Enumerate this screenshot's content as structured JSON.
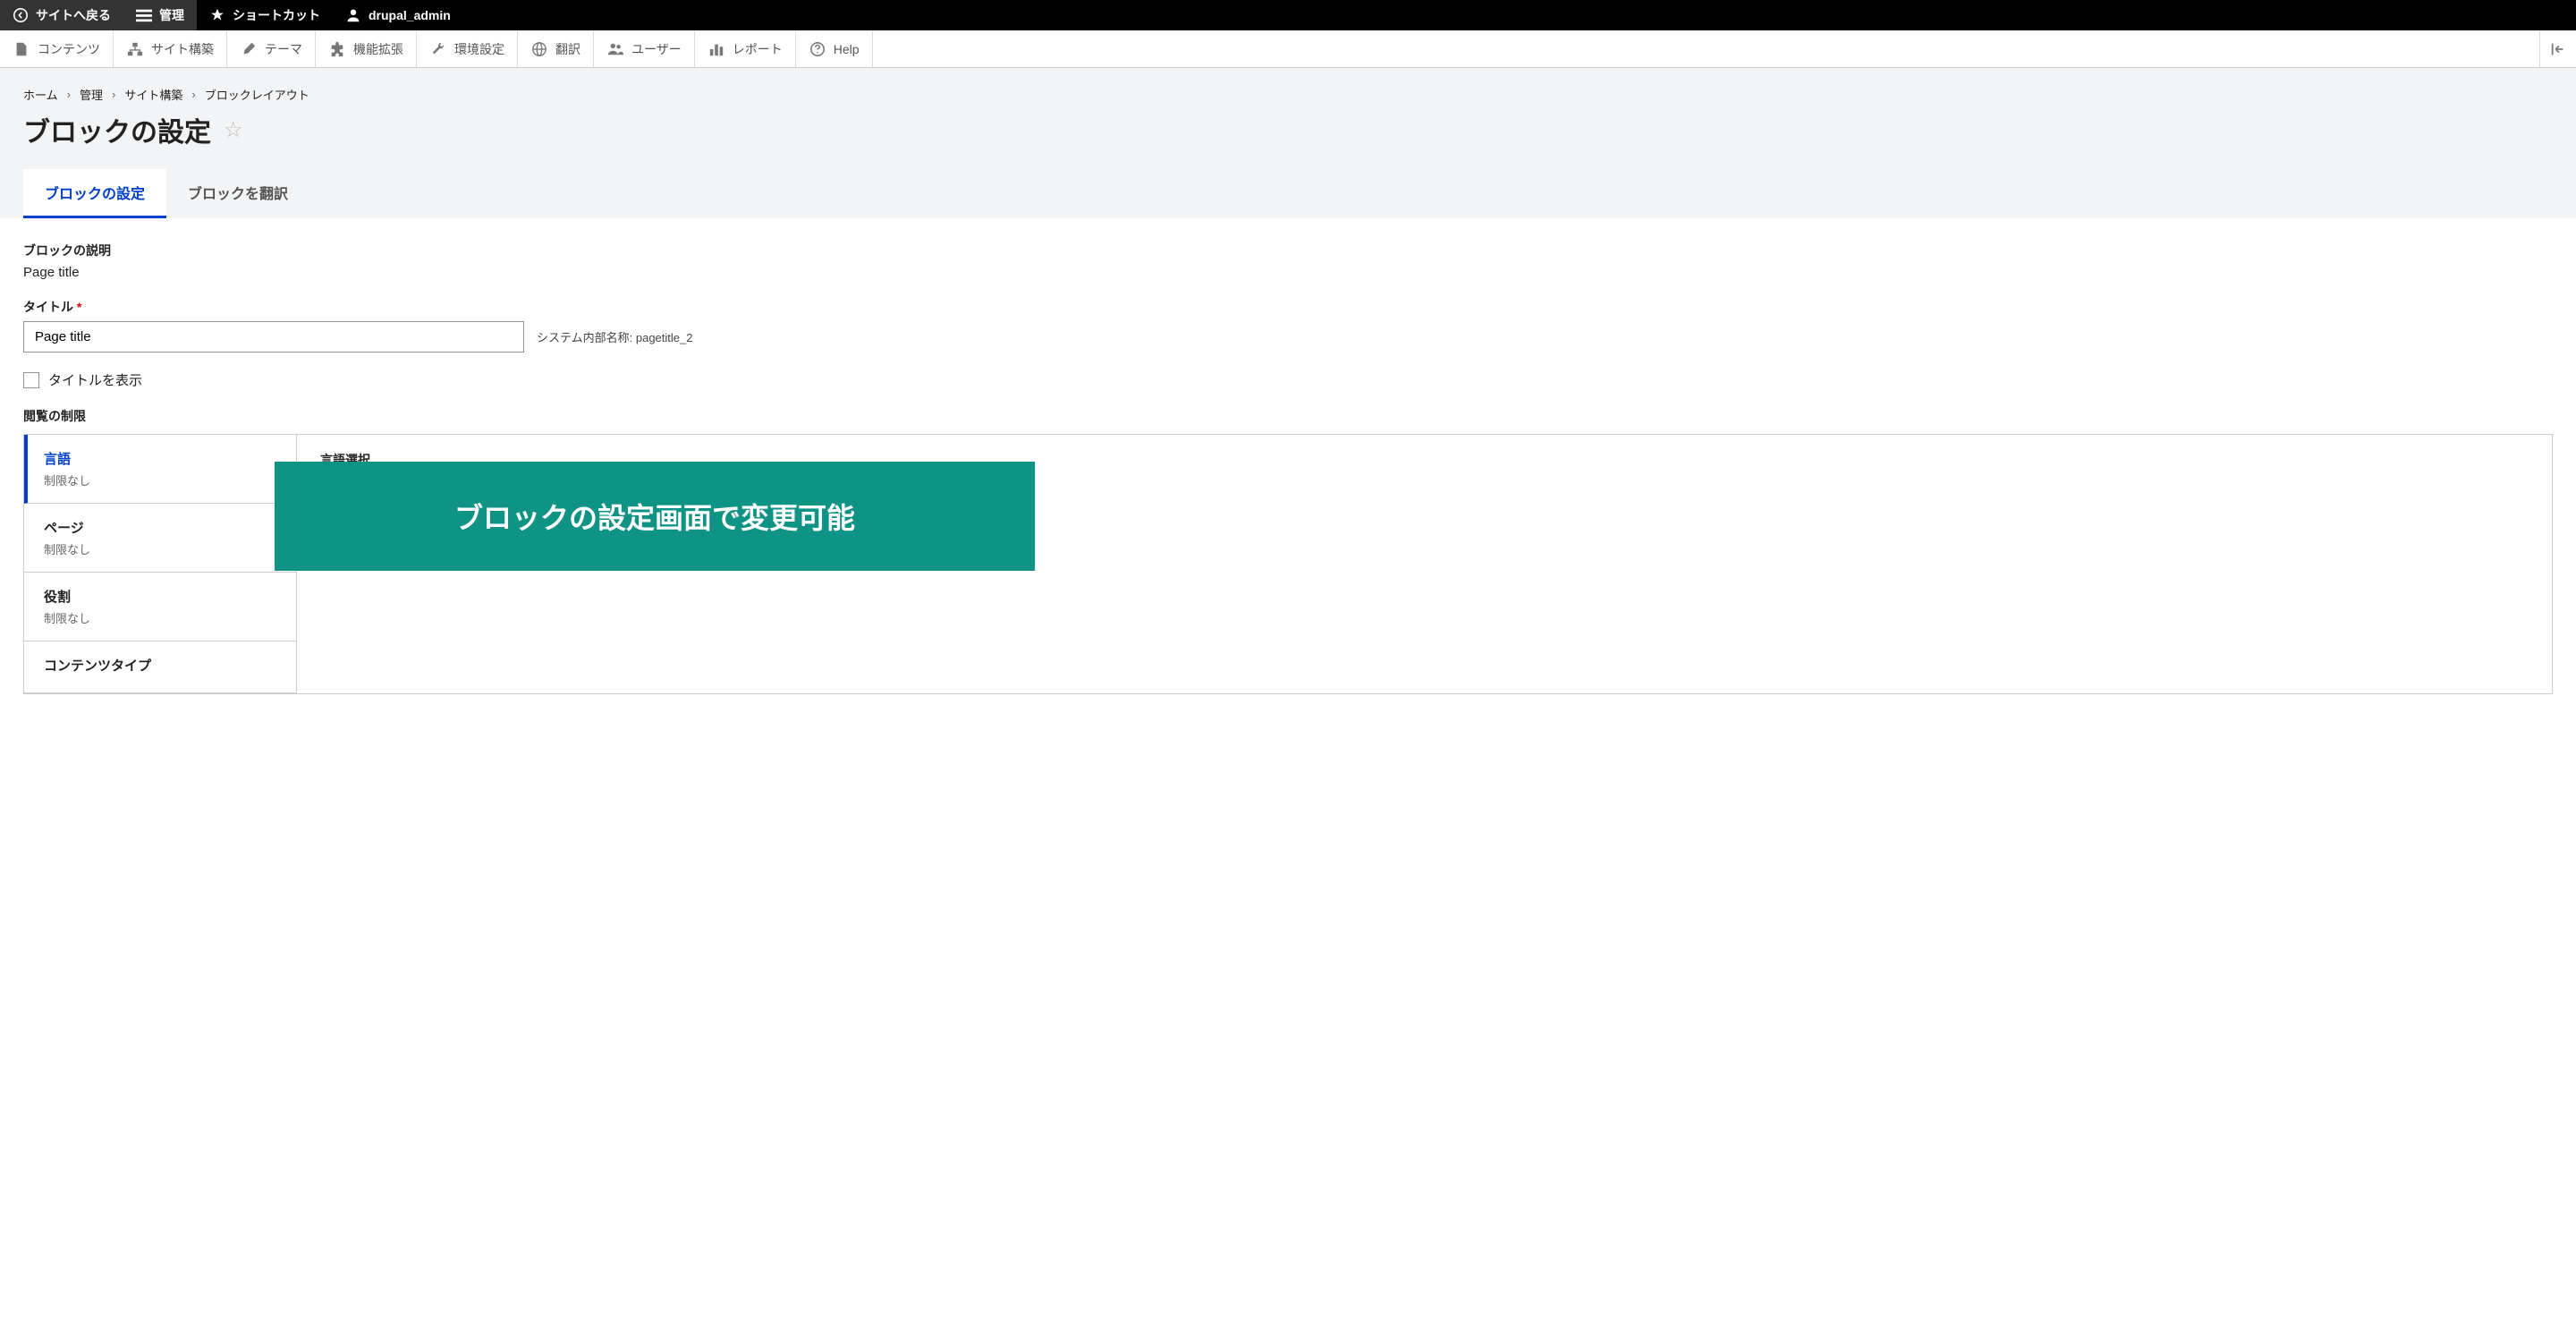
{
  "topbar": {
    "back": "サイトへ戻る",
    "manage": "管理",
    "shortcuts": "ショートカット",
    "user": "drupal_admin"
  },
  "toolbar": {
    "items": [
      {
        "label": "コンテンツ"
      },
      {
        "label": "サイト構築"
      },
      {
        "label": "テーマ"
      },
      {
        "label": "機能拡張"
      },
      {
        "label": "環境設定"
      },
      {
        "label": "翻訳"
      },
      {
        "label": "ユーザー"
      },
      {
        "label": "レポート"
      },
      {
        "label": "Help"
      }
    ]
  },
  "breadcrumb": {
    "items": [
      "ホーム",
      "管理",
      "サイト構築",
      "ブロックレイアウト"
    ],
    "sep": "›"
  },
  "page_title": "ブロックの設定",
  "tabs": [
    {
      "label": "ブロックの設定",
      "active": true
    },
    {
      "label": "ブロックを翻訳",
      "active": false
    }
  ],
  "form": {
    "description_label": "ブロックの説明",
    "description_value": "Page title",
    "title_label": "タイトル",
    "title_value": "Page title",
    "machine_name_label": "システム内部名称:",
    "machine_name_value": "pagetitle_2",
    "show_title_label": "タイトルを表示",
    "visibility_label": "閲覧の制限"
  },
  "vtabs": [
    {
      "title": "言語",
      "summary": "制限なし",
      "active": true
    },
    {
      "title": "ページ",
      "summary": "制限なし",
      "active": false
    },
    {
      "title": "役割",
      "summary": "制限なし",
      "active": false
    },
    {
      "title": "コンテンツタイプ",
      "summary": "",
      "active": false
    }
  ],
  "vtab_content": {
    "language_select_label": "言語選択"
  },
  "callout": "ブロックの設定画面で変更可能"
}
